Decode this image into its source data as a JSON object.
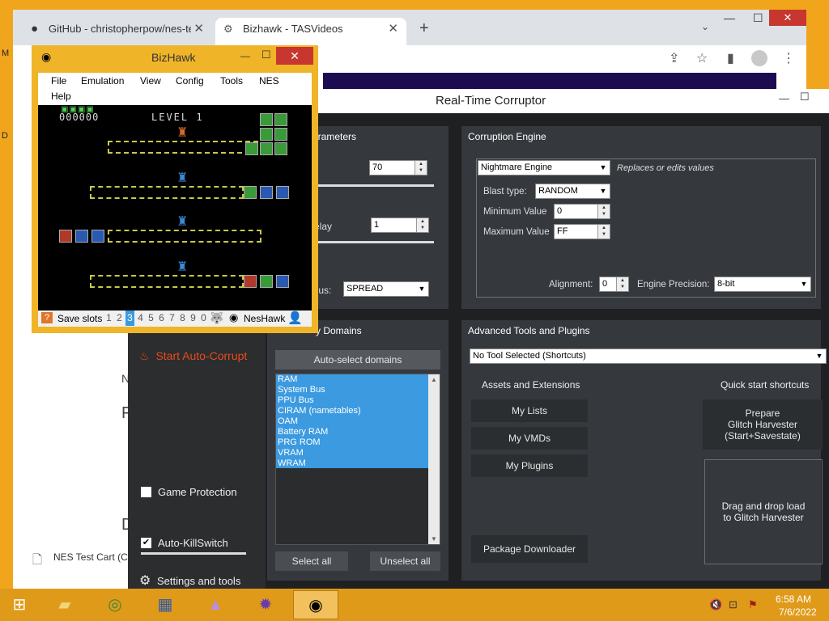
{
  "browser": {
    "tabs": [
      {
        "title": "GitHub - christopherpow/nes-te"
      },
      {
        "title": "Bizhawk - TASVideos"
      }
    ],
    "new_tab": "+"
  },
  "bg_page": {
    "list_item": "NES Test Cart (C",
    "frag1": "N",
    "frag2": "F",
    "frag3": "D"
  },
  "rtc": {
    "title": "Real-Time Corruptor",
    "sidebar": {
      "start": "Start Auto-Corrupt",
      "game_protection": "Game Protection",
      "auto_killswitch": "Auto-KillSwitch",
      "settings": "Settings and tools"
    },
    "params": {
      "title": "arameters",
      "value1": "70",
      "delay_label": "elay",
      "value2": "1",
      "radius_label": "dius:",
      "radius_value": "SPREAD"
    },
    "engine": {
      "title": "Corruption Engine",
      "selected": "Nightmare Engine",
      "desc": "Replaces or edits values",
      "blast_type_label": "Blast type:",
      "blast_type": "RANDOM",
      "min_label": "Minimum Value",
      "min_value": "0",
      "max_label": "Maximum Value",
      "max_value": "FF",
      "alignment_label": "Alignment:",
      "alignment_value": "0",
      "precision_label": "Engine Precision:",
      "precision_value": "8-bit"
    },
    "domains": {
      "title": "y Domains",
      "auto_select": "Auto-select domains",
      "items": [
        "RAM",
        "System Bus",
        "PPU Bus",
        "CIRAM (nametables)",
        "OAM",
        "Battery RAM",
        "PRG ROM",
        "VRAM",
        "WRAM"
      ],
      "select_all": "Select all",
      "unselect_all": "Unselect all"
    },
    "advanced": {
      "title": "Advanced Tools and Plugins",
      "tool_select": "No Tool Selected (Shortcuts)",
      "assets_title": "Assets and Extensions",
      "my_lists": "My Lists",
      "my_vmds": "My VMDs",
      "my_plugins": "My Plugins",
      "package_downloader": "Package Downloader",
      "quick_title": "Quick start shortcuts",
      "prepare_l1": "Prepare",
      "prepare_l2": "Glitch Harvester",
      "prepare_l3": "(Start+Savestate)",
      "drag_l1": "Drag and drop load",
      "drag_l2": "to Glitch Harvester"
    }
  },
  "bizhawk": {
    "title": "BizHawk",
    "menu": [
      "File",
      "Emulation",
      "View",
      "Config",
      "Tools",
      "NES",
      "Help"
    ],
    "game": {
      "level": "LEVEL 1",
      "score": "000000"
    },
    "status": {
      "save_slots": "Save slots",
      "slots": [
        "1",
        "2",
        "3",
        "4",
        "5",
        "6",
        "7",
        "8",
        "9",
        "0"
      ],
      "selected_slot": "3",
      "core": "NesHawk"
    }
  },
  "taskbar": {
    "time": "6:58 AM",
    "date": "7/6/2022"
  },
  "colors": {
    "rtc_accent": "#e84a1d",
    "domain_selected": "#3c9ae0",
    "desktop": "#f0a51c"
  }
}
